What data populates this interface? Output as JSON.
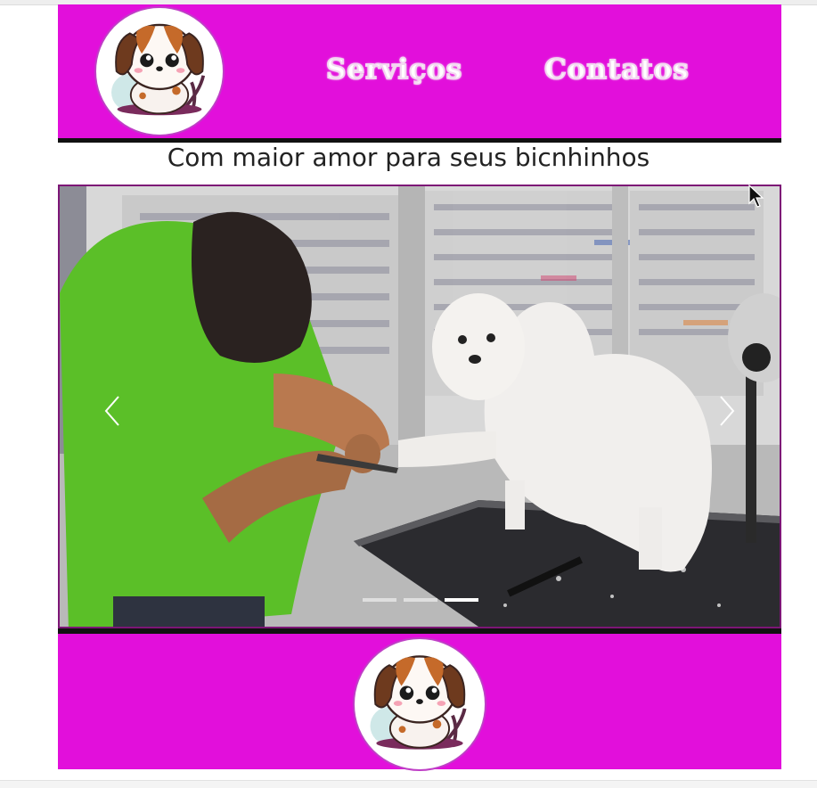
{
  "nav": {
    "services_label": "Serviços",
    "contacts_label": "Contatos"
  },
  "hero": {
    "tagline": "Com maior amor para seus bicnhinhos"
  },
  "carousel": {
    "slide_count": 3,
    "active_slide": 3
  },
  "colors": {
    "brand_magenta": "#e20fdb",
    "divider": "#111111",
    "carousel_border": "#7d1676"
  },
  "icons": {
    "logo": "puppy-logo",
    "prev": "chevron-left-icon",
    "next": "chevron-right-icon",
    "cursor": "mouse-pointer-icon"
  }
}
